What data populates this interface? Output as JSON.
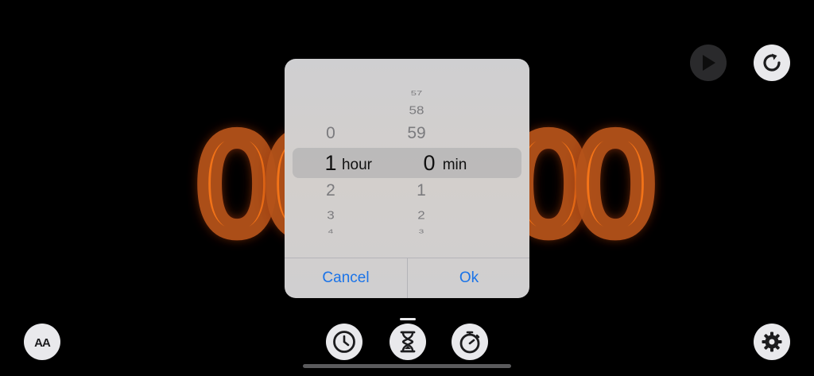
{
  "background_digits": [
    "0",
    "0",
    "0",
    "0"
  ],
  "picker": {
    "hours": {
      "above": [
        "0"
      ],
      "selected": "1",
      "below": [
        "2",
        "3",
        "4"
      ],
      "unit": "hour"
    },
    "minutes": {
      "above": [
        "57",
        "58",
        "59"
      ],
      "selected": "0",
      "below": [
        "1",
        "2",
        "3"
      ],
      "unit": "min"
    }
  },
  "dialog": {
    "cancel_label": "Cancel",
    "ok_label": "Ok"
  },
  "toolbar": {
    "font_size_label": "AA",
    "top_buttons": [
      "play-icon",
      "refresh-icon"
    ],
    "bottom_tabs": [
      "clock-icon",
      "hourglass-icon",
      "stopwatch-icon"
    ],
    "settings": "gear-icon"
  },
  "colors": {
    "accent": "#1a73e8",
    "fire": "#c2410c"
  }
}
